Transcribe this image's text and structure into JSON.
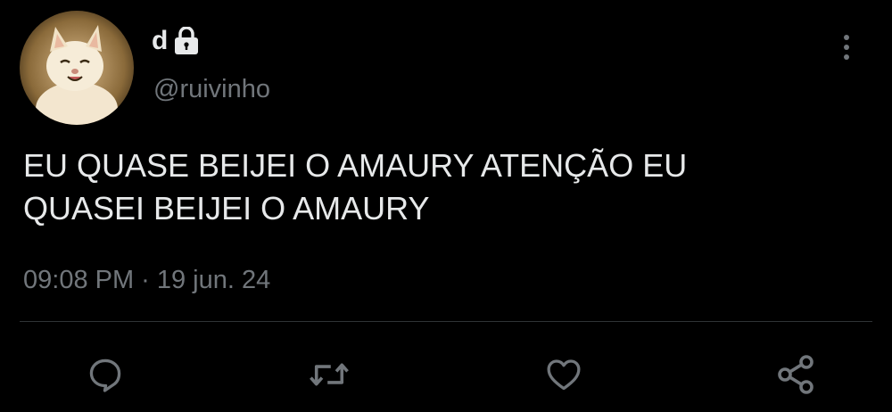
{
  "tweet": {
    "display_name": "d",
    "handle": "@ruivinho",
    "text": "EU QUASE BEIJEI O AMAURY ATENÇÃO EU\nQUASEI BEIJEI O AMAURY",
    "time": "09:08 PM",
    "separator": "·",
    "date": "19 jun. 24"
  },
  "icons": {
    "lock": "lock-icon",
    "more": "more-vertical-icon",
    "reply": "reply-icon",
    "retweet": "retweet-icon",
    "like": "heart-icon",
    "share": "share-icon"
  },
  "colors": {
    "background": "#000000",
    "text": "#e7e9ea",
    "secondary": "#71767b",
    "divider": "#2f3336"
  }
}
